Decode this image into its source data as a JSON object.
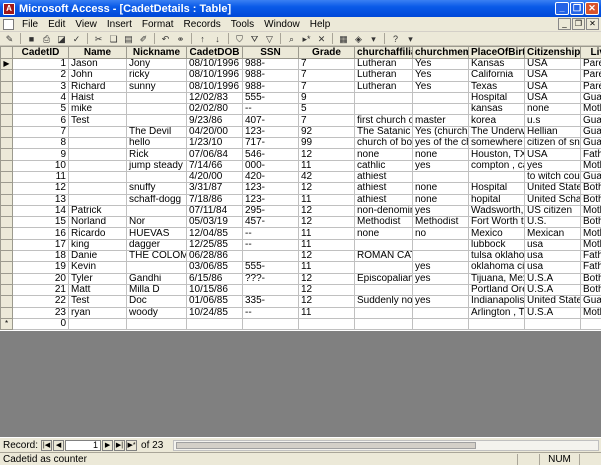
{
  "window": {
    "title": "Microsoft Access - [CadetDetails : Table]"
  },
  "menu": {
    "items": [
      "File",
      "Edit",
      "View",
      "Insert",
      "Format",
      "Records",
      "Tools",
      "Window",
      "Help"
    ]
  },
  "toolbar": {
    "icons": [
      "view-icon",
      "save-icon",
      "print-icon",
      "print-preview-icon",
      "spelling-icon",
      "cut-icon",
      "copy-icon",
      "paste-icon",
      "format-painter-icon",
      "undo-icon",
      "insert-hyperlink-icon",
      "sort-ascending-icon",
      "sort-descending-icon",
      "filter-by-selection-icon",
      "filter-by-form-icon",
      "apply-filter-icon",
      "find-icon",
      "new-record-icon",
      "delete-record-icon",
      "database-window-icon",
      "new-object-icon",
      "help-icon"
    ]
  },
  "grid": {
    "columns": [
      "CadetID",
      "Name",
      "Nickname",
      "CadetDOB",
      "SSN",
      "Grade",
      "churchaffiliati",
      "churchmembe",
      "PlaceOfBirth",
      "Citizenship",
      "Live"
    ],
    "rows": [
      [
        "1",
        "Jason",
        "Jony",
        "08/10/1996",
        "988-",
        "7",
        "Lutheran",
        "Yes",
        "Kansas",
        "USA",
        "Parent"
      ],
      [
        "2",
        "John",
        "ricky",
        "08/10/1996",
        "988-",
        "7",
        "Lutheran",
        "Yes",
        "California",
        "USA",
        "Parent"
      ],
      [
        "3",
        "Richard",
        "sunny",
        "08/10/1996",
        "988-",
        "7",
        "Lutheran",
        "Yes",
        "Texas",
        "USA",
        "Parent"
      ],
      [
        "4",
        "Haist",
        "",
        "12/02/83",
        "555-",
        "9",
        "",
        "",
        "Hospital",
        "USA",
        "Guardi"
      ],
      [
        "5",
        "mike",
        "",
        "02/02/80",
        "--",
        "5",
        "",
        "",
        "kansas",
        "none",
        "Mothe"
      ],
      [
        "6",
        "Test",
        "",
        "9/23/86",
        "407-",
        "7",
        "first church of s",
        "master",
        "korea",
        "u.s",
        "Guardi"
      ],
      [
        "7",
        "",
        "The Devil",
        "04/20/00",
        "123-",
        "92",
        "The Satanic Chu",
        "Yes (church He",
        "The Underworld",
        "Hellian",
        "Guardi"
      ],
      [
        "8",
        "",
        "hello",
        "1/23/10",
        "717-",
        "99",
        "church of bob",
        "yes of the churc",
        "somewhere in th",
        "citizen of snorflu",
        "Guardi"
      ],
      [
        "9",
        "",
        "Rick",
        "07/06/84",
        "546-",
        "12",
        "none",
        "none",
        "Houston, TX",
        "USA",
        "Fathe"
      ],
      [
        "10",
        "",
        "jump steady",
        "7/14/66",
        "000-",
        "11",
        "cathlic",
        "yes",
        "compton , califo",
        "yes",
        "Mothe"
      ],
      [
        "11",
        "",
        "",
        "4/20/00",
        "420-",
        "42",
        "athiest",
        "",
        "",
        "to witch country",
        "Guardi"
      ],
      [
        "12",
        "",
        "snuffy",
        "3/31/87",
        "123-",
        "12",
        "athiest",
        "none",
        "Hospital",
        "United States",
        "Both F"
      ],
      [
        "13",
        "",
        "schaff-dogg",
        "7/18/86",
        "123-",
        "11",
        "athiest",
        "none",
        "hopital",
        "United Schafer",
        "Both F"
      ],
      [
        "14",
        "Patrick",
        "",
        "07/11/84",
        "295-",
        "12",
        "non-denominatio",
        "yes",
        "Wadsworth, Oh",
        "US citizen",
        "Mothe"
      ],
      [
        "15",
        "Norland",
        "Nor",
        "05/03/19",
        "457-",
        "12",
        "Methodist",
        "Methodist",
        "Fort Worth texa",
        "U.S.",
        "Both F"
      ],
      [
        "16",
        "Ricardo",
        "HUEVAS",
        "12/04/85",
        "--",
        "11",
        "none",
        "no",
        "Mexico",
        "Mexican",
        "Mothe"
      ],
      [
        "17",
        "king",
        "dagger",
        "12/25/85",
        "--",
        "11",
        "",
        "",
        "lubbock",
        "usa",
        "Mothe"
      ],
      [
        "18",
        "Danie",
        "THE COLOMBI",
        "06/28/86",
        "",
        "12",
        "ROMAN CATHO",
        "",
        "tulsa oklahoma",
        "usa",
        "Fathe"
      ],
      [
        "19",
        "Kevin",
        "",
        "03/06/85",
        "555-",
        "11",
        "",
        "yes",
        "oklahoma city",
        "usa",
        "Fathe"
      ],
      [
        "20",
        "Tyler",
        "Gandhi",
        "6/15/86",
        "???-",
        "12",
        "Episcopalian",
        "yes",
        "Tijuana, Mexico",
        "U.S.A",
        "Both F"
      ],
      [
        "21",
        "Matt",
        "Milla D",
        "10/15/86",
        "",
        "12",
        "",
        "",
        "Portland Oregon",
        "U.S.A",
        "Both F"
      ],
      [
        "22",
        "Test",
        "Doc",
        "01/06/85",
        "335-",
        "12",
        "Suddenly non-al",
        "yes",
        "Indianapolis, Inc",
        "United States",
        "Guardi"
      ],
      [
        "23",
        "ryan",
        "woody",
        "10/24/85",
        "--",
        "11",
        "",
        "",
        "Arlington , Tx.",
        "U.S.A",
        "Mothe"
      ]
    ],
    "new_row_id": "0",
    "current_marker": "▶",
    "new_marker": "*"
  },
  "navigation": {
    "label": "Record:",
    "current": "1",
    "of_text": "of  23"
  },
  "status": {
    "text": "Cadetid as counter",
    "num": "NUM"
  }
}
